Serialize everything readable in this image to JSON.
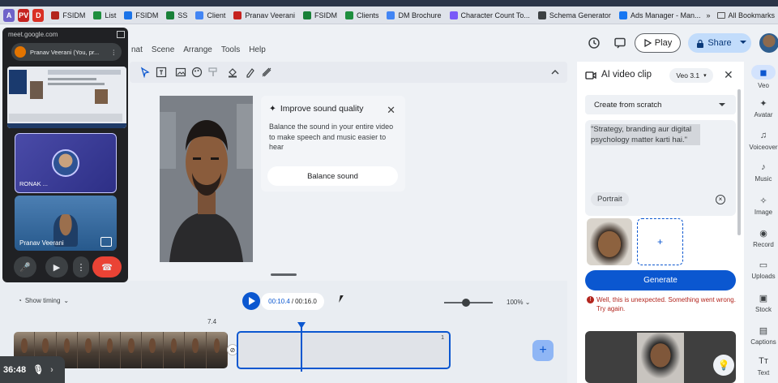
{
  "browser": {
    "profile_badges": [
      {
        "label": "A",
        "color": "#6f63c9"
      },
      {
        "label": "PV",
        "color": "#c5221f"
      },
      {
        "label": "D",
        "color": "#d93025"
      }
    ],
    "bookmarks": [
      {
        "label": "FSIDM",
        "color": "#b3261e"
      },
      {
        "label": "List",
        "color": "#1e8e3e"
      },
      {
        "label": "FSIDM",
        "color": "#1a73e8"
      },
      {
        "label": "SS",
        "color": "#188038"
      },
      {
        "label": "Client",
        "color": "#4285f4"
      },
      {
        "label": "Pranav Veerani",
        "color": "#c5221f"
      },
      {
        "label": "FSIDM",
        "color": "#188038"
      },
      {
        "label": "Clients",
        "color": "#1e8e3e"
      },
      {
        "label": "DM Brochure",
        "color": "#4285f4"
      },
      {
        "label": "Character Count To...",
        "color": "#7a5af8"
      },
      {
        "label": "Schema Generator",
        "color": "#3c4043"
      },
      {
        "label": "Ads Manager - Man...",
        "color": "#1877f2"
      }
    ],
    "all_bookmarks": "All Bookmarks",
    "overflow": "»"
  },
  "app": {
    "menus": [
      "nat",
      "Scene",
      "Arrange",
      "Tools",
      "Help"
    ],
    "play_label": "Play",
    "share_label": "Share"
  },
  "tip": {
    "title": "Improve sound quality",
    "body": "Balance the sound in your entire video to make speech and music easier to hear",
    "button": "Balance sound"
  },
  "playback": {
    "show_timing": "Show timing",
    "current_time": "00:10.4",
    "total_time": "00:16.0",
    "zoom": "100%",
    "zoom_level": 0.45,
    "clip_length": "7.4",
    "empty_clip_index": "1"
  },
  "ai_panel": {
    "title": "AI video clip",
    "model": "Veo 3.1",
    "mode": "Create from scratch",
    "prompt": "\"Strategy, branding aur digital psychology matter karti hai.\"",
    "aspect": "Portrait",
    "generate": "Generate",
    "error": "Well, this is unexpected. Something went wrong. Try again."
  },
  "rail": [
    {
      "label": "Veo",
      "icon": "veo-icon",
      "glyph": "◼"
    },
    {
      "label": "Avatar",
      "icon": "avatar-icon",
      "glyph": "✦"
    },
    {
      "label": "Voiceover",
      "icon": "voiceover-icon",
      "glyph": "♫"
    },
    {
      "label": "Music",
      "icon": "music-icon",
      "glyph": "♪"
    },
    {
      "label": "Image",
      "icon": "image-icon",
      "glyph": "✧"
    },
    {
      "label": "Record",
      "icon": "record-icon",
      "glyph": "◉"
    },
    {
      "label": "Uploads",
      "icon": "uploads-icon",
      "glyph": "▭"
    },
    {
      "label": "Stock",
      "icon": "stock-icon",
      "glyph": "▣"
    },
    {
      "label": "Captions",
      "icon": "captions-icon",
      "glyph": "▤"
    },
    {
      "label": "Text",
      "icon": "text-icon",
      "glyph": "Tт"
    }
  ],
  "meet": {
    "url": "meet.google.com",
    "self_name": "Pranav Veerani (You, pr...",
    "tile_name": "RONAK ...",
    "cam_name": "Pranav Veerani",
    "timer": "36:48"
  }
}
